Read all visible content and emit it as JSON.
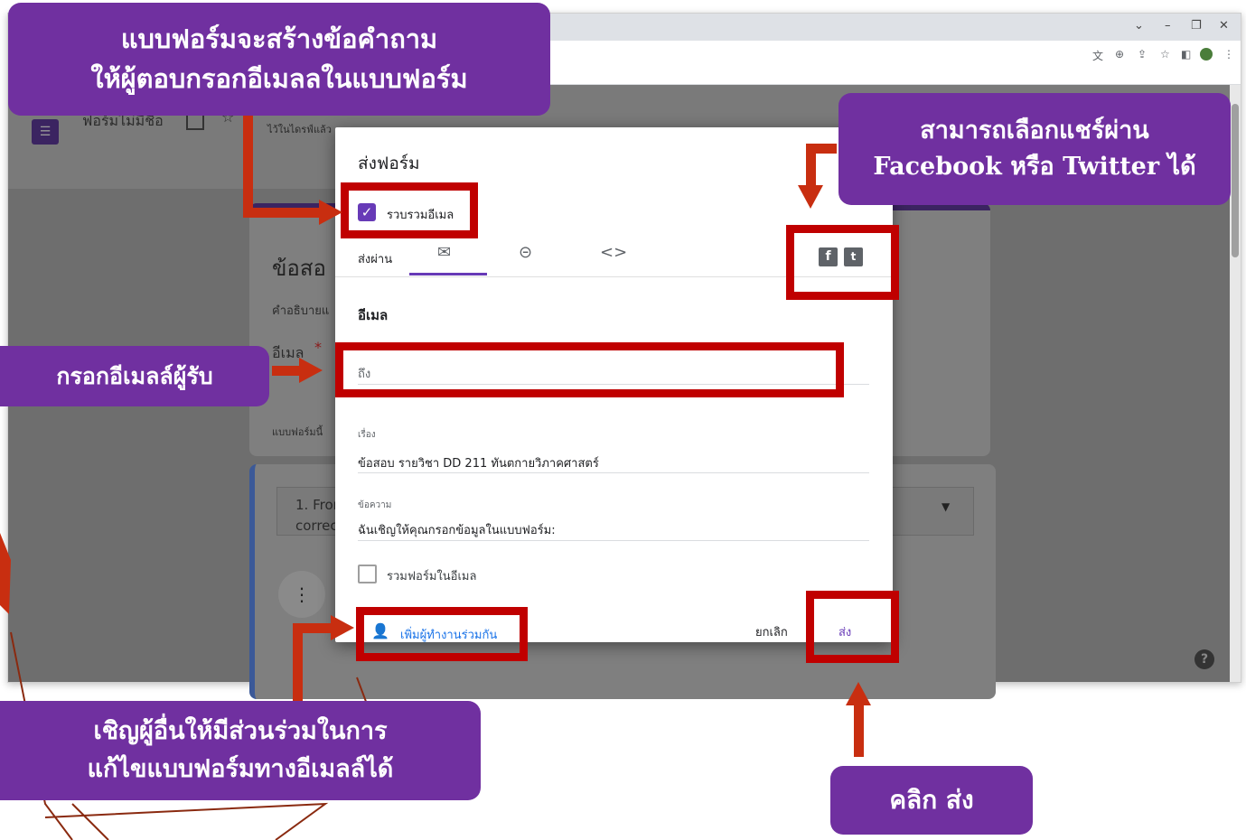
{
  "browser": {
    "controls": {
      "dropdown": "⌄",
      "minimize": "–",
      "restore": "❐",
      "close": "✕"
    },
    "toolbar_icons": [
      "translate-icon",
      "zoom-icon",
      "share-icon",
      "star-icon",
      "sidepanel-icon",
      "profile-icon",
      "menu-icon"
    ]
  },
  "forms_header": {
    "title": "ฟอร์มไม่มีชื่อ",
    "saved_status": "ไว้ในไดรฟ์แล้ว"
  },
  "background_form": {
    "title_partial": "ข้อสอ",
    "description_partial": "คำอธิบายแ",
    "email_label": "อีเมล",
    "required_mark": "*",
    "note_partial": "แบบฟอร์มนี้",
    "question_partial_1": "1. From",
    "question_partial_2": "correc"
  },
  "dialog": {
    "title": "ส่งฟอร์ม",
    "collect_email_label": "รวบรวมอีเมล",
    "send_via_label": "ส่งผ่าน",
    "section_heading": "อีเมล",
    "to_placeholder": "ถึง",
    "subject_label": "เรื่อง",
    "subject_value": "ข้อสอบ รายวิชา DD 211 ทันตกายวิภาคศาสตร์",
    "message_label": "ข้อความ",
    "message_value": "ฉันเชิญให้คุณกรอกข้อมูลในแบบฟอร์ม:",
    "include_form_label": "รวมฟอร์มในอีเมล",
    "add_collaborators": "เพิ่มผู้ทำงานร่วมกัน",
    "cancel": "ยกเลิก",
    "send": "ส่ง",
    "accent_color": "#673ab7"
  },
  "callouts": {
    "top_left_line1": "แบบฟอร์มจะสร้างข้อคำถาม",
    "top_left_line2": "ให้ผู้ตอบกรอกอีเมลลในแบบฟอร์ม",
    "share_line1": "สามารถเลือกแชร์ผ่าน",
    "share_line2": "Facebook หรือ Twitter ได้",
    "recipient": "กรอกอีเมลล์ผู้รับ",
    "invite_line1": "เชิญผู้อื่นให้มีส่วนร่วมในการ",
    "invite_line2": "แก้ไขแบบฟอร์มทางอีเมลล์ได้",
    "click_send": "คลิก ส่ง",
    "callout_color": "#7030a0",
    "highlight_color": "#c00000",
    "arrow_color": "#c82e10"
  }
}
